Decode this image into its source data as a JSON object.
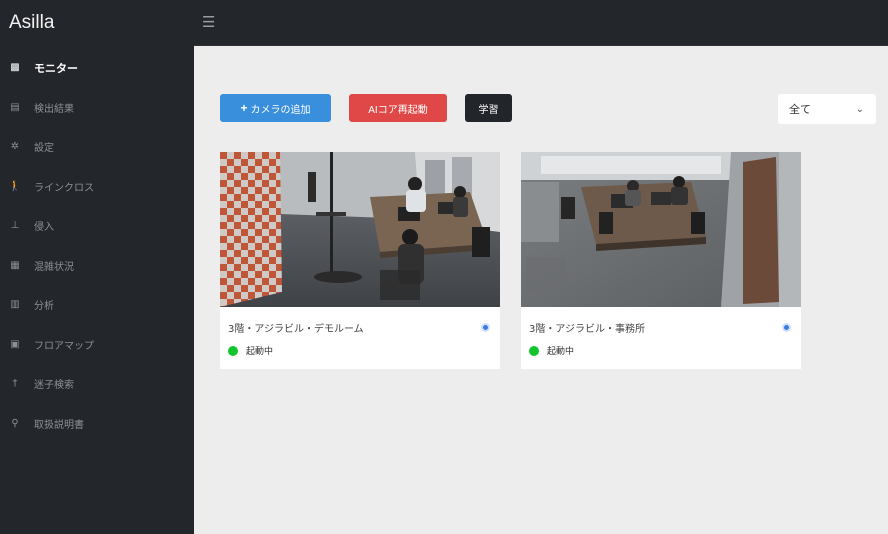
{
  "app": {
    "brand": "Asilla"
  },
  "topbar": {
    "menu_icon": "hamburger-icon"
  },
  "sidebar": {
    "items": [
      {
        "label": "モニター",
        "icon": "monitor-icon",
        "glyph": "▩",
        "active": true
      },
      {
        "label": "検出結果",
        "icon": "list-icon",
        "glyph": "▤",
        "active": false
      },
      {
        "label": "設定",
        "icon": "gear-icon",
        "glyph": "✲",
        "active": false
      },
      {
        "label": "ラインクロス",
        "icon": "walking-person-icon",
        "glyph": "🚶",
        "active": false
      },
      {
        "label": "侵入",
        "icon": "intrusion-icon",
        "glyph": "⊥",
        "active": false
      },
      {
        "label": "混雑状況",
        "icon": "crowd-icon",
        "glyph": "▦",
        "active": false
      },
      {
        "label": "分析",
        "icon": "bar-chart-icon",
        "glyph": "▥",
        "active": false
      },
      {
        "label": "フロアマップ",
        "icon": "map-icon",
        "glyph": "▣",
        "active": false
      },
      {
        "label": "迷子検索",
        "icon": "person-search-icon",
        "glyph": "†",
        "active": false
      },
      {
        "label": "取扱説明書",
        "icon": "manual-icon",
        "glyph": "⚲",
        "active": false
      }
    ]
  },
  "toolbar": {
    "add_camera": "カメラの追加",
    "restart_ai": "AIコア再起動",
    "learn": "学習",
    "filter_value": "全て"
  },
  "cameras": [
    {
      "title": "3階・アジラビル・デモルーム",
      "status": "起動中"
    },
    {
      "title": "3階・アジラビル・事務所",
      "status": "起動中"
    }
  ],
  "colors": {
    "sidebar_bg": "#23262b",
    "primary": "#3a8fdc",
    "danger": "#e04848",
    "dark": "#22262b",
    "status_ok": "#13c42c",
    "info": "#3d7be0"
  }
}
